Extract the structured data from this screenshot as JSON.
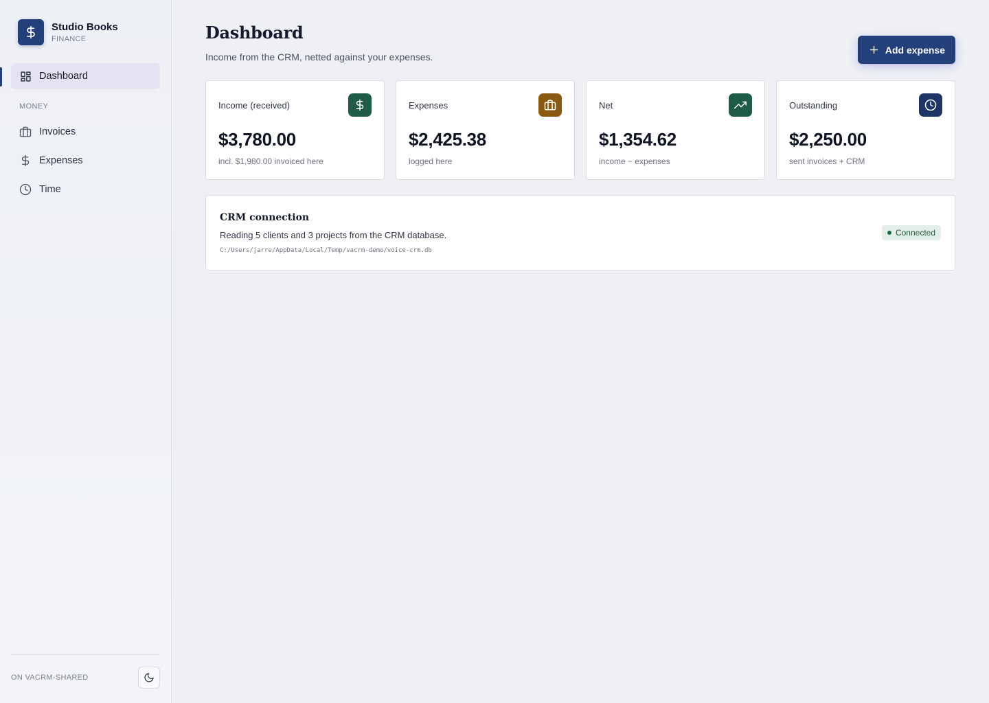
{
  "brand": {
    "name": "Studio Books",
    "subtitle": "FINANCE",
    "logo_icon": "dollar-icon",
    "logo_color": "#23407a"
  },
  "sidebar": {
    "items": [
      {
        "label": "Dashboard",
        "icon": "grid-icon",
        "active": true
      }
    ],
    "section_label": "MONEY",
    "section_items": [
      {
        "label": "Invoices",
        "icon": "briefcase-icon"
      },
      {
        "label": "Expenses",
        "icon": "dollar-icon"
      },
      {
        "label": "Time",
        "icon": "clock-icon"
      }
    ],
    "footer_text": "ON VACRM-SHARED",
    "theme_toggle_icon": "moon-icon"
  },
  "header": {
    "title": "Dashboard",
    "subtitle": "Income from the CRM, netted against your expenses.",
    "add_button_label": "Add expense",
    "add_button_icon": "plus-icon"
  },
  "stats": [
    {
      "label": "Income (received)",
      "value": "$3,780.00",
      "note": "incl. $1,980.00 invoiced here",
      "icon": "dollar-icon",
      "icon_color": "#1f5c45"
    },
    {
      "label": "Expenses",
      "value": "$2,425.38",
      "note": "logged here",
      "icon": "briefcase-icon",
      "icon_color": "#8a5a12"
    },
    {
      "label": "Net",
      "value": "$1,354.62",
      "note": "income − expenses",
      "icon": "trending-up-icon",
      "icon_color": "#1f5c45"
    },
    {
      "label": "Outstanding",
      "value": "$2,250.00",
      "note": "sent invoices + CRM",
      "icon": "clock-icon",
      "icon_color": "#1f3566"
    }
  ],
  "crm": {
    "title": "CRM connection",
    "description": "Reading 5 clients and 3 projects from the CRM database.",
    "path": "C:/Users/jarre/AppData/Local/Temp/vacrm-demo/voice-crm.db",
    "status": "Connected",
    "status_color": "#1e5a3e"
  },
  "colors": {
    "accent": "#23407a",
    "background": "#eef0f4",
    "active_nav": "#e5e2f1"
  }
}
